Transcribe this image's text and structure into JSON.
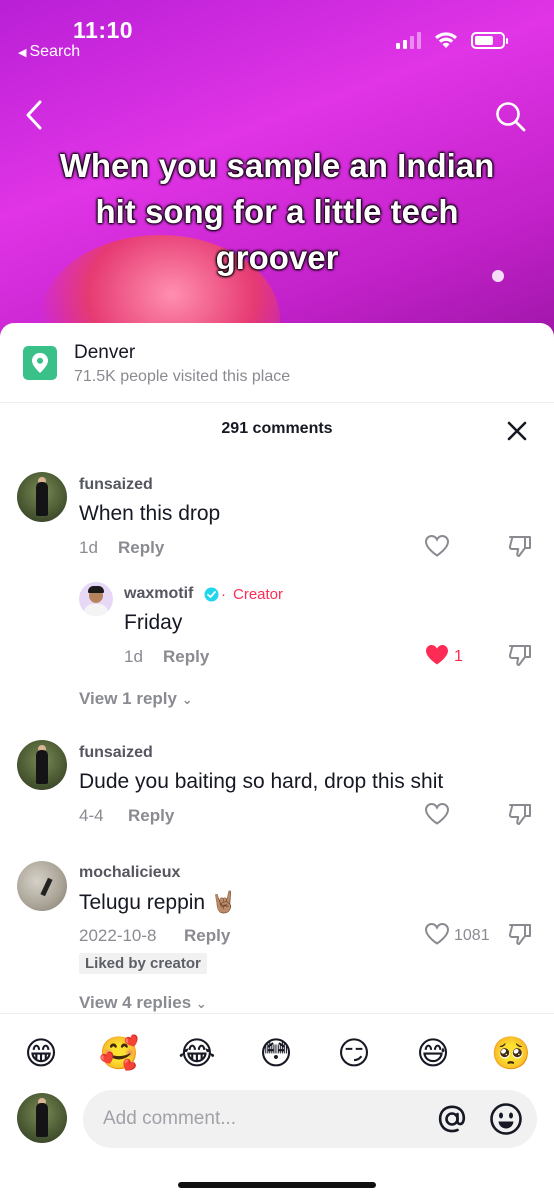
{
  "status_bar": {
    "time": "11:10",
    "back_app": "Search",
    "battery_level": 0.68
  },
  "video": {
    "caption": "When you sample an Indian hit song for a little tech groover",
    "nav_back_icon": "chevron-left-icon",
    "nav_search_icon": "search-icon"
  },
  "location": {
    "name": "Denver",
    "subtitle": "71.5K people visited this place",
    "icon": "map-pin-icon",
    "color": "#3ac18a"
  },
  "comments_header": {
    "title": "291 comments",
    "close_icon": "close-icon"
  },
  "comments": [
    {
      "username": "funsaized",
      "text": "When this drop",
      "time": "1d",
      "reply_label": "Reply",
      "likes": "",
      "liked": false,
      "replies": [
        {
          "username": "waxmotif",
          "verified": true,
          "tag": "Creator",
          "text": "Friday",
          "time": "1d",
          "reply_label": "Reply",
          "likes": "1",
          "liked": true
        }
      ],
      "view_replies": "View 1 reply"
    },
    {
      "username": "funsaized",
      "text": "Dude you baiting so hard, drop this shit",
      "time": "4-4",
      "reply_label": "Reply",
      "likes": "",
      "liked": false
    },
    {
      "username": "mochalicieux",
      "text": "Telugu reppin 🤘🏽",
      "time": "2022-10-8",
      "reply_label": "Reply",
      "likes": "1081",
      "liked": false,
      "badge": "Liked by creator",
      "view_replies": "View 4 replies"
    }
  ],
  "emoji_bar": [
    "😁",
    "🥰",
    "😂",
    "😳",
    "😏",
    "😅",
    "🥺"
  ],
  "composer": {
    "placeholder": "Add comment...",
    "mention_icon": "at-icon",
    "emoji_icon": "smile-icon"
  },
  "colors": {
    "accent": "#fe2c55",
    "header_gradient": "#d42de0",
    "verified": "#20d5ec"
  }
}
